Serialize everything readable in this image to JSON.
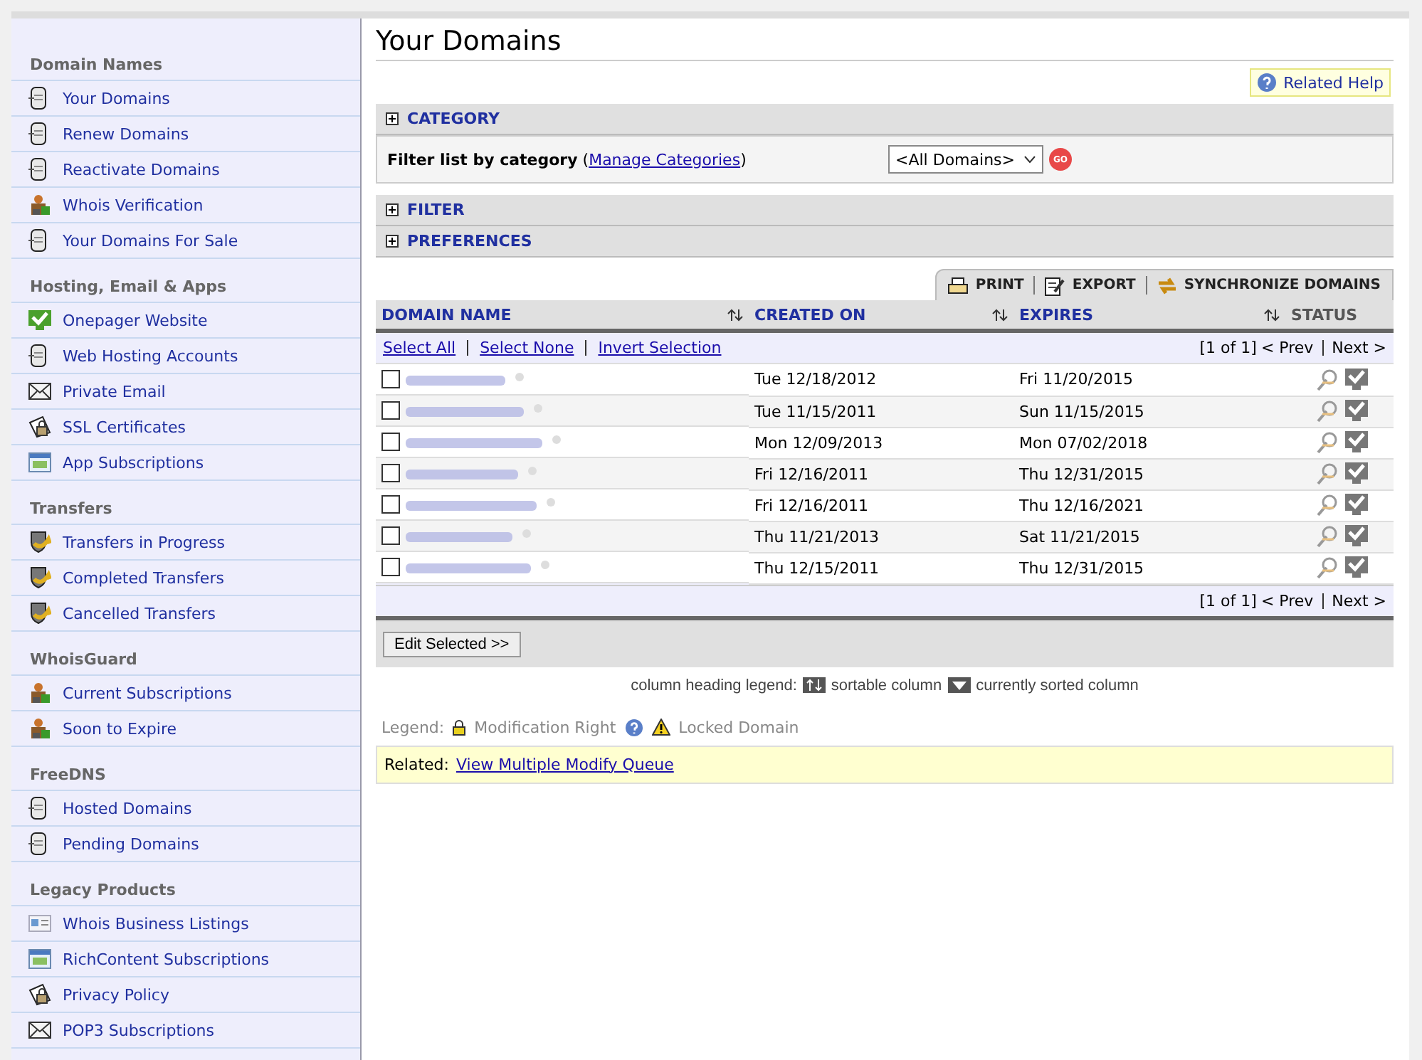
{
  "sidebar": [
    {
      "heading": "Domain Names",
      "items": [
        {
          "label": "Your Domains",
          "kind": "server"
        },
        {
          "label": "Renew Domains",
          "kind": "server"
        },
        {
          "label": "Reactivate Domains",
          "kind": "server"
        },
        {
          "label": "Whois Verification",
          "kind": "people"
        },
        {
          "label": "Your Domains For Sale",
          "kind": "server"
        }
      ]
    },
    {
      "heading": "Hosting, Email & Apps",
      "items": [
        {
          "label": "Onepager Website",
          "kind": "check"
        },
        {
          "label": "Web Hosting Accounts",
          "kind": "server"
        },
        {
          "label": "Private Email",
          "kind": "mail"
        },
        {
          "label": "SSL Certificates",
          "kind": "lock"
        },
        {
          "label": "App Subscriptions",
          "kind": "window"
        }
      ]
    },
    {
      "heading": "Transfers",
      "items": [
        {
          "label": "Transfers in Progress",
          "kind": "transfer"
        },
        {
          "label": "Completed Transfers",
          "kind": "transfer"
        },
        {
          "label": "Cancelled Transfers",
          "kind": "transfer"
        }
      ]
    },
    {
      "heading": "WhoisGuard",
      "items": [
        {
          "label": "Current Subscriptions",
          "kind": "people"
        },
        {
          "label": "Soon to Expire",
          "kind": "people"
        }
      ]
    },
    {
      "heading": "FreeDNS",
      "items": [
        {
          "label": "Hosted Domains",
          "kind": "server"
        },
        {
          "label": "Pending Domains",
          "kind": "server"
        }
      ]
    },
    {
      "heading": "Legacy Products",
      "items": [
        {
          "label": "Whois Business Listings",
          "kind": "card"
        },
        {
          "label": "RichContent Subscriptions",
          "kind": "window"
        },
        {
          "label": "Privacy Policy",
          "kind": "lock"
        },
        {
          "label": "POP3 Subscriptions",
          "kind": "mail"
        }
      ]
    }
  ],
  "page_title": "Your Domains",
  "related_help": "Related Help",
  "sections": [
    {
      "label": "CATEGORY"
    },
    {
      "label": "FILTER"
    },
    {
      "label": "PREFERENCES"
    }
  ],
  "category_filter": {
    "label": "Filter list by category",
    "open": "(",
    "link": "Manage Categories",
    "close": ")",
    "select_value": "<All Domains>",
    "go": "GO"
  },
  "toolbar": [
    "PRINT",
    "EXPORT",
    "SYNCHRONIZE DOMAINS"
  ],
  "table": {
    "columns": [
      {
        "label": "DOMAIN NAME",
        "sortable": true
      },
      {
        "label": "CREATED ON",
        "sortable": true
      },
      {
        "label": "EXPIRES",
        "sortable": true
      },
      {
        "label": "STATUS",
        "sortable": false
      }
    ],
    "selection_links": [
      "Select All",
      "Select None",
      "Invert Selection"
    ],
    "pager": {
      "count": "[1 of 1]",
      "prev": "< Prev",
      "next": "Next >"
    },
    "rows": [
      {
        "checked": false,
        "created": "Tue 12/18/2012",
        "expires": "Fri 11/20/2015"
      },
      {
        "checked": false,
        "created": "Tue 11/15/2011",
        "expires": "Sun 11/15/2015"
      },
      {
        "checked": false,
        "created": "Mon 12/09/2013",
        "expires": "Mon 07/02/2018"
      },
      {
        "checked": false,
        "created": "Fri 12/16/2011",
        "expires": "Thu 12/31/2015"
      },
      {
        "checked": false,
        "created": "Fri 12/16/2011",
        "expires": "Thu 12/16/2021"
      },
      {
        "checked": false,
        "created": "Thu 11/21/2013",
        "expires": "Sat 11/21/2015"
      },
      {
        "checked": false,
        "created": "Thu 12/15/2011",
        "expires": "Thu 12/31/2015"
      }
    ],
    "bottom_pager": {
      "count": "[1 of 1]",
      "prev": "< Prev",
      "next": "Next >"
    },
    "edit_button": "Edit Selected >>"
  },
  "heading_legend": {
    "label": "column heading legend:",
    "sortable": "sortable column",
    "sorted": "currently sorted column"
  },
  "legend": {
    "label": "Legend:",
    "items": [
      "Modification Right",
      "Locked Domain"
    ]
  },
  "related": {
    "label": "Related:",
    "link": "View Multiple Modify Queue"
  }
}
